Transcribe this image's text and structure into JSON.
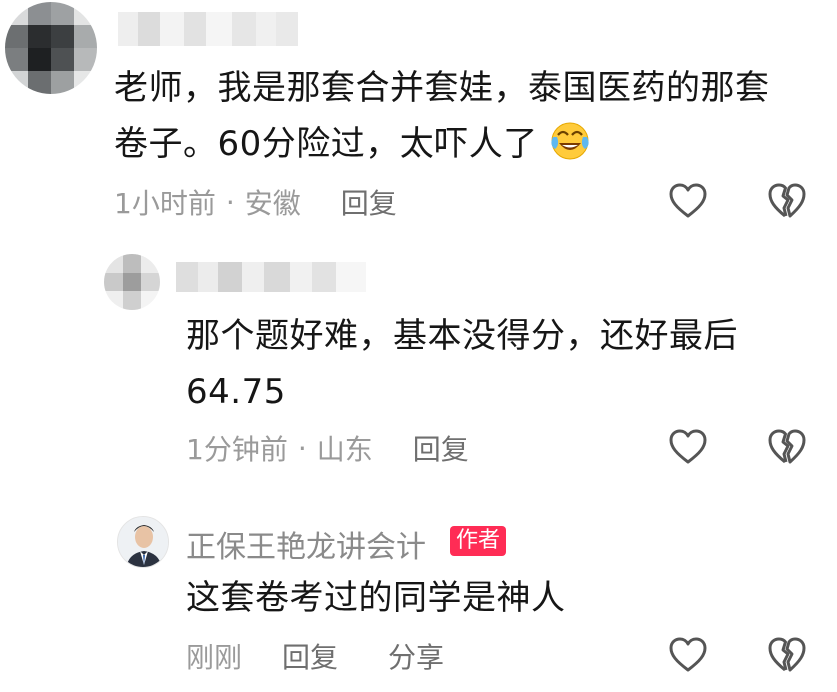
{
  "comments": [
    {
      "text_line1": "老师，我是那套合并套娃，泰国医药的那套",
      "text_line2": "卷子。60分险过，太吓人了",
      "emoji": "crying-laughing-emoji",
      "time": "1小时前",
      "separator": "·",
      "location": "安徽",
      "reply": "回复"
    },
    {
      "text_line1": "那个题好难，基本没得分，还好最后",
      "text_line2": "64.75",
      "time": "1分钟前",
      "separator": "·",
      "location": "山东",
      "reply": "回复"
    },
    {
      "author_name": "正保王艳龙讲会计",
      "author_badge": "作者",
      "text_line1": "这套卷考过的同学是神人",
      "time": "刚刚",
      "reply": "回复",
      "share": "分享"
    }
  ],
  "icons": {
    "like": "heart-outline-icon",
    "dislike": "broken-heart-icon"
  },
  "colors": {
    "badge": "#ff2c55",
    "meta": "#9a9a9a",
    "text": "#161616"
  }
}
